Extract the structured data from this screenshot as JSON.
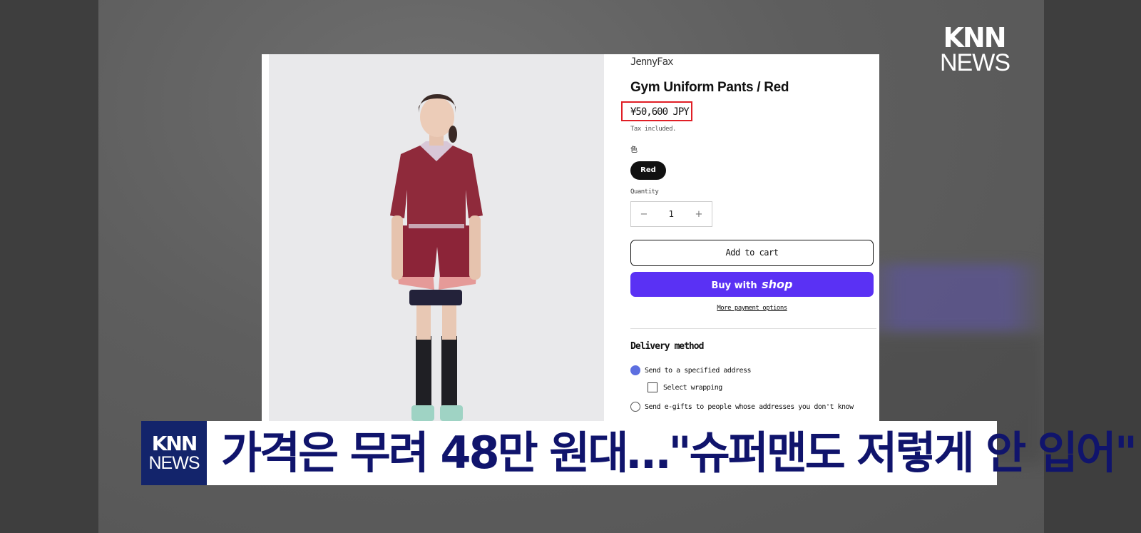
{
  "broadcaster": {
    "logo_top": {
      "line1": "KNN",
      "line2": "NEWS"
    },
    "caption_logo": {
      "line1": "KNN",
      "line2": "NEWS"
    }
  },
  "product_page": {
    "brand": "JennyFax",
    "title": "Gym Uniform Pants / Red",
    "price": "¥50,600 JPY",
    "tax_note": "Tax included.",
    "color_label": "色",
    "color_option": "Red",
    "quantity_label": "Quantity",
    "quantity_value": "1",
    "decrement": "−",
    "increment": "+",
    "add_to_cart": "Add to cart",
    "buy_with": "Buy with",
    "shop_brand": "shop",
    "more_payment": "More payment options",
    "delivery_heading": "Delivery method",
    "delivery_options": [
      {
        "label": "Send to a specified address",
        "selected": true
      },
      {
        "label": "Select wrapping",
        "type": "checkbox",
        "checked": false
      },
      {
        "label": "Send e-gifts to people whose addresses you don't know",
        "selected": false
      }
    ],
    "accent_colors": {
      "shop_button": "#5a31f4",
      "price_highlight": "#e01f26",
      "radio_selected": "#5d6fe0"
    }
  },
  "caption": {
    "headline": "가격은 무려 48만 원대…\"슈퍼맨도 저렇게 안 입어\""
  }
}
